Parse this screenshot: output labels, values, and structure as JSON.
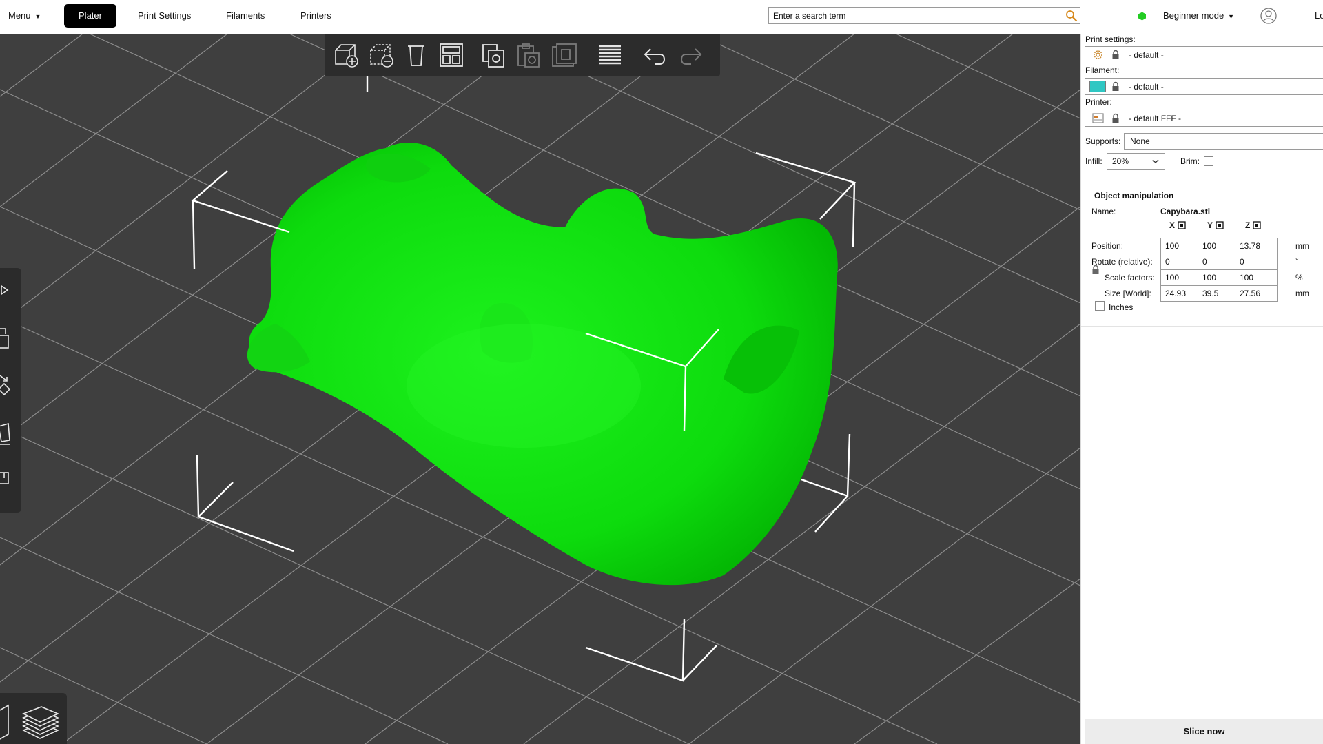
{
  "topbar": {
    "menu_label": "Menu",
    "tabs": [
      {
        "label": "Plater",
        "active": true
      },
      {
        "label": "Print Settings",
        "active": false
      },
      {
        "label": "Filaments",
        "active": false
      },
      {
        "label": "Printers",
        "active": false
      }
    ],
    "search_placeholder": "Enter a search term",
    "mode_label": "Beginner mode",
    "mode_color": "#22cc22",
    "login_label": "Lo"
  },
  "viewport": {
    "background": "#3f3f3f",
    "model_color": "#00ee00",
    "top_toolbar": [
      "add-icon",
      "delete-icon",
      "delete-all-icon",
      "arrange-icon",
      "copy-icon",
      "paste-icon",
      "instance-icon",
      "layers-edit-icon",
      "undo-icon",
      "redo-icon"
    ],
    "left_toolbar": [
      "move-icon",
      "scale-icon",
      "rotate-icon",
      "place-on-face-icon",
      "cut-icon"
    ],
    "view_toggle": [
      "3d-view-icon",
      "preview-icon"
    ]
  },
  "sidebar": {
    "print_settings_label": "Print settings:",
    "print_settings_value": "- default -",
    "filament_label": "Filament:",
    "filament_value": "- default -",
    "filament_color": "#2fc7c3",
    "printer_label": "Printer:",
    "printer_value": "- default FFF -",
    "supports_label": "Supports:",
    "supports_value": "None",
    "infill_label": "Infill:",
    "infill_value": "20%",
    "brim_label": "Brim:",
    "brim_checked": false,
    "object_manipulation": {
      "title": "Object manipulation",
      "name_label": "Name:",
      "name_value": "Capybara.stl",
      "axes": [
        "X",
        "Y",
        "Z"
      ],
      "position_label": "Position:",
      "position": [
        "100",
        "100",
        "13.78"
      ],
      "position_unit": "mm",
      "rotate_label": "Rotate (relative):",
      "rotate": [
        "0",
        "0",
        "0"
      ],
      "rotate_unit": "°",
      "scale_label": "Scale factors:",
      "scale": [
        "100",
        "100",
        "100"
      ],
      "scale_unit": "%",
      "size_label": "Size [World]:",
      "size": [
        "24.93",
        "39.5",
        "27.56"
      ],
      "size_unit": "mm",
      "inches_label": "Inches",
      "inches_checked": false
    },
    "slice_label": "Slice now"
  }
}
